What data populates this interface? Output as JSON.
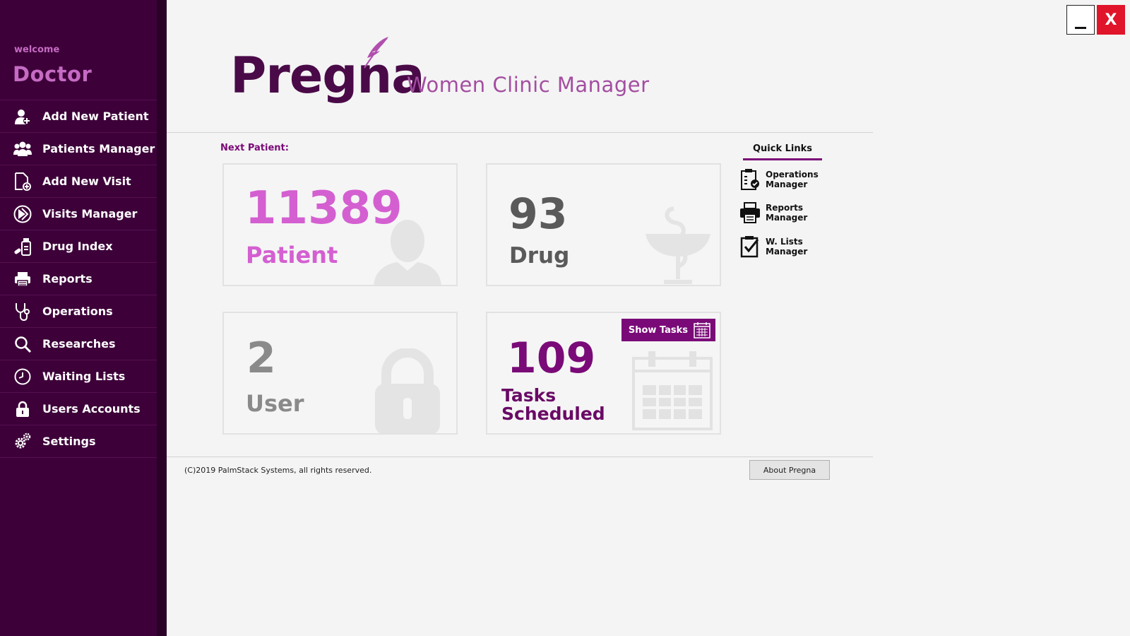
{
  "sidebar": {
    "welcome": "welcome",
    "user_role": "Doctor",
    "items": [
      {
        "label": "Add New Patient",
        "icon": "add-user-icon"
      },
      {
        "label": "Patients Manager",
        "icon": "users-icon"
      },
      {
        "label": "Add New Visit",
        "icon": "file-add-icon"
      },
      {
        "label": "Visits Manager",
        "icon": "visits-icon"
      },
      {
        "label": "Drug Index",
        "icon": "drug-icon"
      },
      {
        "label": "Reports",
        "icon": "printer-icon"
      },
      {
        "label": "Operations",
        "icon": "stethoscope-icon"
      },
      {
        "label": "Researches",
        "icon": "search-icon"
      },
      {
        "label": "Waiting Lists",
        "icon": "clock-icon"
      },
      {
        "label": "Users Accounts",
        "icon": "lock-icon"
      },
      {
        "label": "Settings",
        "icon": "gear-icon"
      }
    ]
  },
  "window": {
    "minimize_label": "_",
    "close_label": "X"
  },
  "header": {
    "app_name": "Pregna",
    "tagline": "Women Clinic Manager"
  },
  "main": {
    "next_patient_label": "Next Patient:",
    "cards": {
      "patient": {
        "value": "11389",
        "caption": "Patient"
      },
      "drug": {
        "value": "93",
        "caption": "Drug"
      },
      "user": {
        "value": "2",
        "caption": "User"
      },
      "tasks": {
        "value": "109",
        "caption": "Tasks\nScheduled",
        "button_label": "Show Tasks"
      }
    }
  },
  "quick_links": {
    "title": "Quick Links",
    "items": [
      {
        "label": "Operations\nManager",
        "icon": "clipboard-check-icon"
      },
      {
        "label": "Reports\nManager",
        "icon": "printer-icon"
      },
      {
        "label": "W. Lists\nManager",
        "icon": "checklist-icon"
      }
    ]
  },
  "footer": {
    "copyright": "(C)2019 PalmStack Systems, all rights reserved.",
    "about_button": "About Pregna"
  },
  "colors": {
    "sidebar_bg": "#3d0039",
    "accent": "#7a0a78",
    "pink": "#d45fd1",
    "close_red": "#e0142b"
  }
}
